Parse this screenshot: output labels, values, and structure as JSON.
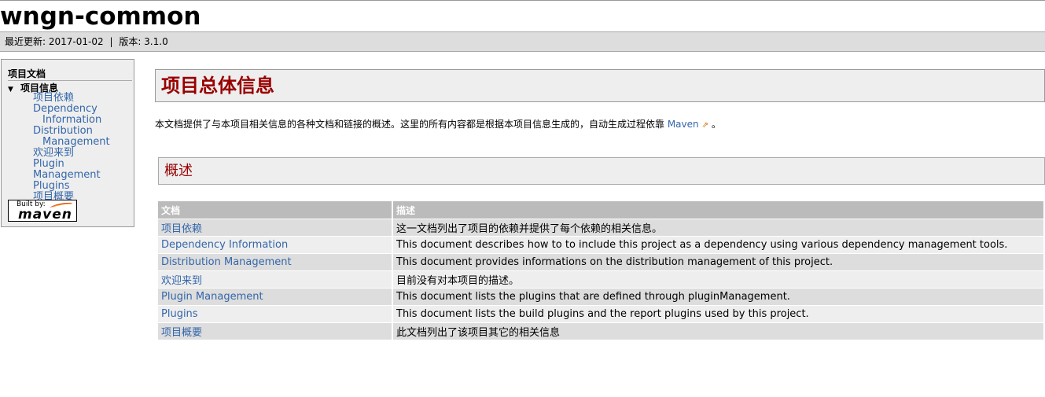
{
  "banner": {
    "title": "wngn-common"
  },
  "breadcrumbs": {
    "last_updated": "最近更新: 2017-01-02",
    "separator": "|",
    "version": "版本: 3.1.0"
  },
  "nav": {
    "title": "项目文档",
    "section": "项目信息",
    "items": [
      {
        "line1": "项目依赖",
        "line2": ""
      },
      {
        "line1": "Dependency",
        "line2": "Information"
      },
      {
        "line1": "Distribution",
        "line2": "Management"
      },
      {
        "line1": "欢迎来到",
        "line2": ""
      },
      {
        "line1": "Plugin Management",
        "line2": ""
      },
      {
        "line1": "Plugins",
        "line2": ""
      },
      {
        "line1": "项目概要",
        "line2": ""
      }
    ],
    "powered_by": {
      "built": "Built by:",
      "name": "maven"
    }
  },
  "main": {
    "heading": "项目总体信息",
    "intro_text": "本文档提供了与本项目相关信息的各种文档和链接的概述。这里的所有内容都是根据本项目信息生成的，自动生成过程依靠 ",
    "intro_link": "Maven",
    "intro_end": " 。",
    "overview_heading": "概述",
    "table": {
      "headers": [
        "文档",
        "描述"
      ],
      "rows": [
        {
          "doc": "项目依赖",
          "desc": "这一文档列出了项目的依赖并提供了每个依赖的相关信息。"
        },
        {
          "doc": "Dependency Information",
          "desc": "This document describes how to to include this project as a dependency using various dependency management tools."
        },
        {
          "doc": "Distribution Management",
          "desc": "This document provides informations on the distribution management of this project."
        },
        {
          "doc": "欢迎来到",
          "desc": "目前没有对本项目的描述。"
        },
        {
          "doc": "Plugin Management",
          "desc": "This document lists the plugins that are defined through pluginManagement."
        },
        {
          "doc": "Plugins",
          "desc": "This document lists the build plugins and the report plugins used by this project."
        },
        {
          "doc": "项目概要",
          "desc": "此文档列出了该项目其它的相关信息"
        }
      ]
    }
  },
  "colors": {
    "link": "#3366aa",
    "heading": "#990000",
    "table_header": "#bbbbbb"
  }
}
